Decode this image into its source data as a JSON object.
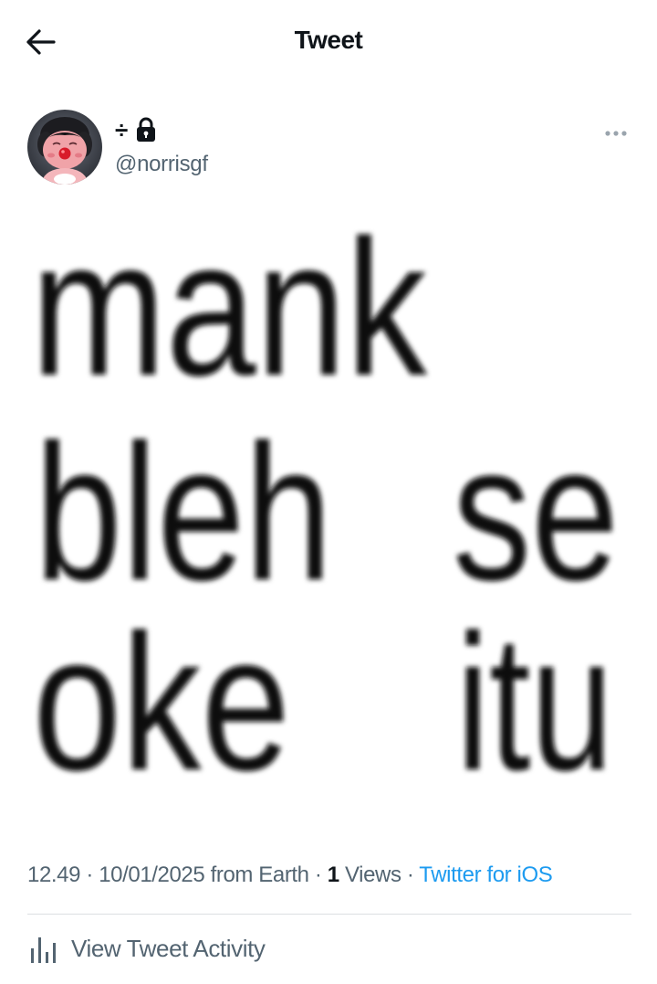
{
  "header": {
    "title": "Tweet",
    "back_icon": "arrow-left-icon"
  },
  "author": {
    "display_name": "÷",
    "protected_icon": "lock-icon",
    "handle": "@norrisgf",
    "avatar": "avatar-pink-plush-character",
    "more_icon": "more-horizontal-icon"
  },
  "media": {
    "words": [
      "mank",
      "bleh",
      "se",
      "oke",
      "itu"
    ]
  },
  "meta": {
    "time": "12.49",
    "sep1": " · ",
    "date": "10/01/2025",
    "location": " from Earth",
    "sep2": " · ",
    "views_count": "1",
    "views_label": " Views",
    "sep3": " · ",
    "source": "Twitter for iOS"
  },
  "activity": {
    "label": "View Tweet Activity",
    "icon": "bar-chart-icon"
  },
  "colors": {
    "text_primary": "#0f1419",
    "text_secondary": "#536471",
    "link": "#1d9bf0",
    "divider": "#dcdfe2"
  }
}
